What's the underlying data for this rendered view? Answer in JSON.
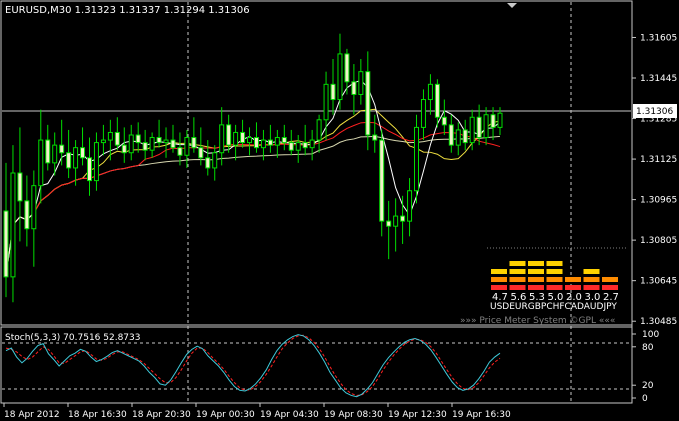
{
  "main_chart": {
    "symbol_header": "EURUSD,M30  1.31323 1.31337 1.31294 1.31306",
    "current_price_label": "1.31306",
    "price_ticks": [
      "1.31605",
      "1.31445",
      "1.31285",
      "1.31125",
      "1.30965",
      "1.30805",
      "1.30645",
      "1.30485"
    ],
    "price_range": [
      1.3047,
      1.31745
    ],
    "price_meter": {
      "values": [
        "4.7",
        "5.6",
        "5.3",
        "5.0",
        "2.0",
        "3.0",
        "2.7"
      ],
      "currencies": [
        "USD",
        "EUR",
        "GBP",
        "CHF",
        "CAD",
        "AUD",
        "JPY"
      ],
      "currency_row": "USDEURGBPCHFCADAUDJPY",
      "strengths": [
        4.7,
        5.6,
        5.3,
        5.0,
        2.0,
        3.0,
        2.7
      ],
      "footer": "»»» Price Meter System ©GPL «««"
    },
    "colors": {
      "bull_body": "#000000",
      "bear_body": "#f2f2c8",
      "candle_wick": "#00dd00",
      "ma_white": "#ffffff",
      "ma_yellow": "#f0e040",
      "ma_red": "#ff2020",
      "ma_slow": "#d8d8b0",
      "grid": "#c8c8c8",
      "meter_red": "#ff2a2a",
      "meter_orange": "#ff8c00",
      "meter_yellow": "#ffd200"
    }
  },
  "stoch_panel": {
    "label": "Stoch(5,3,3) 70.7516 52.8733",
    "ticks": [
      "100",
      "80",
      "20",
      "0"
    ],
    "main_color": "#3ec9d9",
    "signal_color": "#ff2020",
    "main_values": [
      74,
      78,
      64,
      55,
      62,
      73,
      82,
      85,
      69,
      60,
      50,
      58,
      66,
      70,
      76,
      73,
      64,
      57,
      60,
      65,
      71,
      74,
      70,
      66,
      62,
      58,
      50,
      40,
      32,
      22,
      20,
      28,
      41,
      55,
      68,
      76,
      81,
      77,
      66,
      58,
      50,
      40,
      28,
      18,
      12,
      11,
      15,
      22,
      32,
      44,
      60,
      74,
      84,
      91,
      96,
      99,
      97,
      91,
      82,
      70,
      56,
      40,
      28,
      16,
      8,
      4,
      2,
      6,
      14,
      24,
      38,
      52,
      63,
      72,
      80,
      87,
      91,
      93,
      90,
      84,
      75,
      63,
      50,
      37,
      25,
      16,
      12,
      14,
      20,
      30,
      42,
      56,
      64,
      70
    ],
    "signal_values": [
      78,
      76,
      72,
      65,
      60,
      64,
      72,
      80,
      76,
      66,
      55,
      54,
      60,
      66,
      72,
      74,
      68,
      61,
      59,
      62,
      68,
      72,
      72,
      68,
      64,
      60,
      54,
      46,
      38,
      30,
      24,
      24,
      32,
      44,
      58,
      70,
      78,
      78,
      71,
      62,
      54,
      45,
      34,
      24,
      16,
      12,
      13,
      18,
      26,
      37,
      50,
      64,
      77,
      86,
      93,
      97,
      98,
      94,
      87,
      77,
      64,
      49,
      35,
      23,
      13,
      7,
      4,
      5,
      10,
      18,
      30,
      44,
      56,
      67,
      76,
      84,
      89,
      92,
      91,
      87,
      80,
      70,
      57,
      44,
      32,
      22,
      15,
      13,
      16,
      24,
      35,
      47,
      56,
      62
    ]
  },
  "time_axis": {
    "labels": [
      "18 Apr 2012",
      "18 Apr 16:30",
      "18 Apr 20:30",
      "19 Apr 00:30",
      "19 Apr 04:30",
      "19 Apr 08:30",
      "19 Apr 12:30",
      "19 Apr 16:30"
    ]
  },
  "ohlc": [
    [
      1.3092,
      1.3111,
      1.3058,
      1.3066
    ],
    [
      1.3066,
      1.3118,
      1.3056,
      1.3107
    ],
    [
      1.3107,
      1.3125,
      1.308,
      1.3096
    ],
    [
      1.3096,
      1.3106,
      1.3078,
      1.3085
    ],
    [
      1.3085,
      1.3108,
      1.307,
      1.3102
    ],
    [
      1.3102,
      1.3132,
      1.3095,
      1.312
    ],
    [
      1.312,
      1.3126,
      1.3108,
      1.3111
    ],
    [
      1.3111,
      1.3123,
      1.3106,
      1.3118
    ],
    [
      1.3118,
      1.3128,
      1.311,
      1.3115
    ],
    [
      1.3115,
      1.3124,
      1.3105,
      1.3109
    ],
    [
      1.3109,
      1.312,
      1.3102,
      1.3117
    ],
    [
      1.3117,
      1.3125,
      1.311,
      1.3113
    ],
    [
      1.3113,
      1.3121,
      1.3098,
      1.3104
    ],
    [
      1.3104,
      1.3123,
      1.31,
      1.3119
    ],
    [
      1.3119,
      1.3126,
      1.3114,
      1.312
    ],
    [
      1.312,
      1.3128,
      1.3112,
      1.3123
    ],
    [
      1.3123,
      1.3129,
      1.3116,
      1.3118
    ],
    [
      1.3118,
      1.3125,
      1.3111,
      1.3115
    ],
    [
      1.3115,
      1.3126,
      1.3112,
      1.3122
    ],
    [
      1.3122,
      1.3127,
      1.3115,
      1.3119
    ],
    [
      1.3119,
      1.3124,
      1.3112,
      1.3116
    ],
    [
      1.3116,
      1.3123,
      1.3113,
      1.3121
    ],
    [
      1.3121,
      1.3128,
      1.3117,
      1.3119
    ],
    [
      1.3119,
      1.3125,
      1.3113,
      1.312
    ],
    [
      1.312,
      1.3126,
      1.3115,
      1.3117
    ],
    [
      1.3117,
      1.3123,
      1.311,
      1.3114
    ],
    [
      1.3114,
      1.3124,
      1.3109,
      1.3121
    ],
    [
      1.3121,
      1.3129,
      1.3115,
      1.3117
    ],
    [
      1.3117,
      1.3125,
      1.311,
      1.3113
    ],
    [
      1.3113,
      1.312,
      1.3106,
      1.3109
    ],
    [
      1.3109,
      1.3118,
      1.3104,
      1.3115
    ],
    [
      1.3115,
      1.3133,
      1.311,
      1.3126
    ],
    [
      1.3126,
      1.313,
      1.3115,
      1.3118
    ],
    [
      1.3118,
      1.3126,
      1.3112,
      1.3123
    ],
    [
      1.3123,
      1.3128,
      1.3117,
      1.3119
    ],
    [
      1.3119,
      1.3125,
      1.3114,
      1.3121
    ],
    [
      1.3121,
      1.3127,
      1.3115,
      1.3117
    ],
    [
      1.3117,
      1.3124,
      1.3112,
      1.312
    ],
    [
      1.312,
      1.3126,
      1.3115,
      1.3118
    ],
    [
      1.3118,
      1.3124,
      1.3113,
      1.3121
    ],
    [
      1.3121,
      1.3126,
      1.3116,
      1.3119
    ],
    [
      1.3119,
      1.3124,
      1.3114,
      1.3116
    ],
    [
      1.3116,
      1.3122,
      1.3111,
      1.3119
    ],
    [
      1.3119,
      1.3126,
      1.3114,
      1.3117
    ],
    [
      1.3117,
      1.3124,
      1.3112,
      1.312
    ],
    [
      1.312,
      1.313,
      1.3115,
      1.3128
    ],
    [
      1.3128,
      1.3147,
      1.312,
      1.3142
    ],
    [
      1.3142,
      1.3152,
      1.313,
      1.3136
    ],
    [
      1.3136,
      1.3162,
      1.3132,
      1.3154
    ],
    [
      1.3154,
      1.3156,
      1.3138,
      1.3143
    ],
    [
      1.3143,
      1.315,
      1.313,
      1.3138
    ],
    [
      1.3138,
      1.3152,
      1.3134,
      1.3147
    ],
    [
      1.3147,
      1.3155,
      1.3116,
      1.3122
    ],
    [
      1.3122,
      1.313,
      1.3115,
      1.312
    ],
    [
      1.312,
      1.3124,
      1.3082,
      1.3088
    ],
    [
      1.3088,
      1.3096,
      1.3073,
      1.3086
    ],
    [
      1.3086,
      1.3097,
      1.3076,
      1.309
    ],
    [
      1.309,
      1.3098,
      1.3079,
      1.3088
    ],
    [
      1.3088,
      1.3105,
      1.3082,
      1.31
    ],
    [
      1.31,
      1.313,
      1.3095,
      1.3125
    ],
    [
      1.3125,
      1.314,
      1.312,
      1.3136
    ],
    [
      1.3136,
      1.3146,
      1.313,
      1.3142
    ],
    [
      1.3142,
      1.3144,
      1.3125,
      1.3129
    ],
    [
      1.3129,
      1.3136,
      1.3122,
      1.3126
    ],
    [
      1.3126,
      1.313,
      1.3115,
      1.3118
    ],
    [
      1.3118,
      1.3127,
      1.3114,
      1.3124
    ],
    [
      1.3124,
      1.3128,
      1.3116,
      1.3119
    ],
    [
      1.3119,
      1.3132,
      1.3116,
      1.3129
    ],
    [
      1.3129,
      1.3134,
      1.3118,
      1.3121
    ],
    [
      1.3121,
      1.3133,
      1.3118,
      1.313
    ],
    [
      1.313,
      1.3133,
      1.312,
      1.3125
    ],
    [
      1.3125,
      1.3133,
      1.3122,
      1.31306
    ]
  ]
}
